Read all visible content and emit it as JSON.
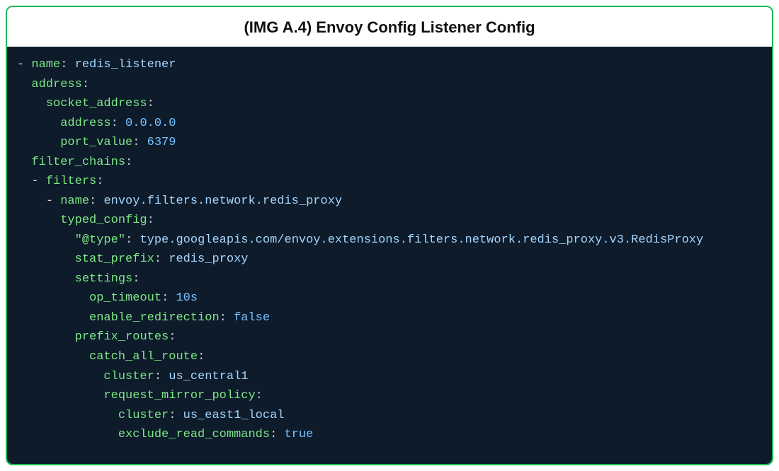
{
  "title": "(IMG A.4) Envoy Config Listener Config",
  "code": {
    "lines": [
      {
        "indent": 0,
        "dash": true,
        "key": "name",
        "value": "redis_listener",
        "vtype": "str"
      },
      {
        "indent": 1,
        "dash": false,
        "key": "address",
        "value": null,
        "vtype": "none"
      },
      {
        "indent": 2,
        "dash": false,
        "key": "socket_address",
        "value": null,
        "vtype": "none"
      },
      {
        "indent": 3,
        "dash": false,
        "key": "address",
        "value": "0.0.0.0",
        "vtype": "num"
      },
      {
        "indent": 3,
        "dash": false,
        "key": "port_value",
        "value": "6379",
        "vtype": "num"
      },
      {
        "indent": 1,
        "dash": false,
        "key": "filter_chains",
        "value": null,
        "vtype": "none"
      },
      {
        "indent": 1,
        "dash": true,
        "key": "filters",
        "value": null,
        "vtype": "none"
      },
      {
        "indent": 2,
        "dash": true,
        "key": "name",
        "value": "envoy.filters.network.redis_proxy",
        "vtype": "str"
      },
      {
        "indent": 3,
        "dash": false,
        "key": "typed_config",
        "value": null,
        "vtype": "none"
      },
      {
        "indent": 4,
        "dash": false,
        "key": "\"@type\"",
        "quoted_key": true,
        "value": "type.googleapis.com/envoy.extensions.filters.network.redis_proxy.v3.RedisProxy",
        "vtype": "str"
      },
      {
        "indent": 4,
        "dash": false,
        "key": "stat_prefix",
        "value": "redis_proxy",
        "vtype": "str"
      },
      {
        "indent": 4,
        "dash": false,
        "key": "settings",
        "value": null,
        "vtype": "none"
      },
      {
        "indent": 5,
        "dash": false,
        "key": "op_timeout",
        "value": "10s",
        "vtype": "num"
      },
      {
        "indent": 5,
        "dash": false,
        "key": "enable_redirection",
        "value": "false",
        "vtype": "bool"
      },
      {
        "indent": 4,
        "dash": false,
        "key": "prefix_routes",
        "value": null,
        "vtype": "none"
      },
      {
        "indent": 5,
        "dash": false,
        "key": "catch_all_route",
        "value": null,
        "vtype": "none"
      },
      {
        "indent": 6,
        "dash": false,
        "key": "cluster",
        "value": "us_central1",
        "vtype": "str"
      },
      {
        "indent": 6,
        "dash": false,
        "key": "request_mirror_policy",
        "value": null,
        "vtype": "none"
      },
      {
        "indent": 7,
        "dash": false,
        "key": "cluster",
        "value": "us_east1_local",
        "vtype": "str"
      },
      {
        "indent": 7,
        "dash": false,
        "key": "exclude_read_commands",
        "value": "true",
        "vtype": "bool"
      }
    ]
  }
}
